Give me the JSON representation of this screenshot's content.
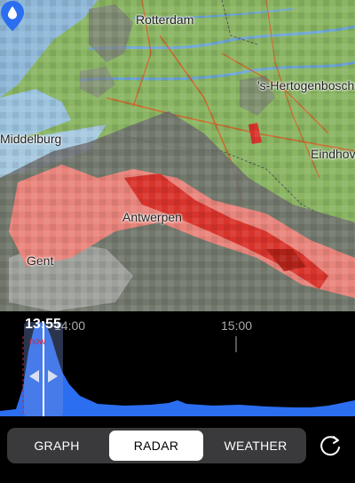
{
  "map": {
    "cities": [
      {
        "name": "Rotterdam"
      },
      {
        "name": "'s-Hertogenbosch"
      },
      {
        "name": "Middelburg"
      },
      {
        "name": "Eindhoven"
      },
      {
        "name": "Antwerpen"
      },
      {
        "name": "Gent"
      }
    ],
    "pin_icon": "water-drop-location-pin",
    "colors": {
      "sea": "#8fb8d8",
      "land": "#8ab563",
      "rain_light": "#e8847c",
      "rain_heavy": "#d8342c",
      "radar_gray": "#6d6d6d"
    }
  },
  "timeline": {
    "current_time": "13:55",
    "now_label": "now",
    "tick_labels": [
      "14:00",
      "15:00"
    ],
    "accent": "#2c6ef0"
  },
  "tabs": [
    {
      "label": "GRAPH",
      "active": false
    },
    {
      "label": "RADAR",
      "active": true
    },
    {
      "label": "WEATHER",
      "active": false
    }
  ],
  "refresh_icon": "refresh-icon"
}
